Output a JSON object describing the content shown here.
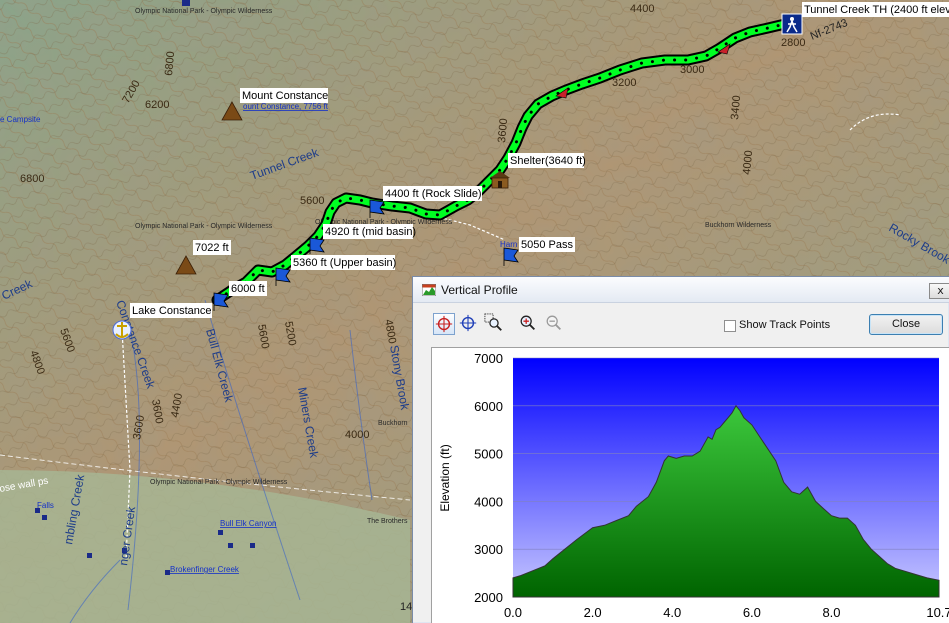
{
  "map": {
    "contour_labels": [
      "4400",
      "6800",
      "7200",
      "6200",
      "6800",
      "5600",
      "4800",
      "5600",
      "4400",
      "3600",
      "3600",
      "5600",
      "5200",
      "4800",
      "4000",
      "4000",
      "3200",
      "3400",
      "3600",
      "3000",
      "2800"
    ],
    "creek_labels": [
      "Tunnel Creek",
      "Creek",
      "Constance Creek",
      "Bull Elk Creek",
      "Miners Creek",
      "Stony Brook",
      "mbling Creek",
      "nger Creek",
      "Rocky Brook"
    ],
    "area_labels": [
      "Olympic National Park - Olympic Wilderness",
      "Olympic National Park - Olympic Wilderness",
      "Olympic National Park - Olympic Wilderness",
      "Olympic National Park - Olympic Wilderness",
      "Buckhorn Wilderness",
      "Buckhorn",
      "The Brothers",
      "ose wall ps"
    ],
    "blue_labels": [
      "e Campsite",
      "ount Constance, 7756 ft",
      "Bull Elk Canyon",
      "Brokenfinger Creek",
      "Falls",
      "Harn"
    ],
    "road_label": "Nf-2743",
    "edge_number": "14",
    "waypoints": [
      {
        "label": "Tunnel Creek TH (2400 ft elev"
      },
      {
        "label": "Shelter(3640 ft)"
      },
      {
        "label": "4400 ft (Rock Slide)"
      },
      {
        "label": "4920 ft (mid basin)"
      },
      {
        "label": "5050 Pass"
      },
      {
        "label": "5360 ft (Upper basin)"
      },
      {
        "label": "6000 ft"
      },
      {
        "label": "Lake Constance"
      },
      {
        "label": "7022 ft"
      },
      {
        "label": "Mount Constance"
      }
    ],
    "colors": {
      "track": "#00ff22",
      "track_outline": "#000000",
      "waypoint_bg": "#ffffff"
    }
  },
  "profile_window": {
    "title": "Vertical Profile",
    "close_glyph": "x",
    "toolbar": [
      {
        "icon": "crosshair-red-icon"
      },
      {
        "icon": "crosshair-blue-icon"
      },
      {
        "icon": "zoom-area-icon"
      },
      {
        "icon": "zoom-in-icon"
      },
      {
        "icon": "zoom-out-icon"
      }
    ],
    "show_track_points_label": "Show Track Points",
    "show_track_points_checked": false,
    "close_button_label": "Close"
  },
  "chart_data": {
    "type": "area",
    "title": "",
    "xlabel": "",
    "ylabel": "Elevation (ft)",
    "xlim": [
      0,
      10.7
    ],
    "ylim": [
      2000,
      7000
    ],
    "x_ticks": [
      "0.0",
      "2.0",
      "4.0",
      "6.0",
      "8.0",
      "10.7"
    ],
    "y_ticks": [
      "2000",
      "3000",
      "4000",
      "5000",
      "6000",
      "7000"
    ],
    "grid": true,
    "colors": {
      "background_top": "#0000ff",
      "background_bottom": "#c8c8ff",
      "fill_top": "#3cc83c",
      "fill_bottom": "#006400",
      "line": "#333333"
    },
    "x": [
      0,
      0.2,
      0.5,
      0.8,
      1.0,
      1.3,
      1.6,
      2.0,
      2.3,
      2.6,
      2.9,
      3.1,
      3.4,
      3.6,
      3.8,
      3.9,
      4.1,
      4.3,
      4.5,
      4.7,
      4.9,
      5.0,
      5.1,
      5.2,
      5.3,
      5.4,
      5.5,
      5.6,
      5.7,
      5.8,
      6.0,
      6.2,
      6.4,
      6.6,
      6.8,
      7.0,
      7.2,
      7.4,
      7.6,
      7.8,
      8.0,
      8.2,
      8.4,
      8.6,
      8.8,
      9.0,
      9.2,
      9.4,
      9.6,
      9.8,
      10.0,
      10.2,
      10.4,
      10.7
    ],
    "y": [
      2400,
      2450,
      2550,
      2650,
      2800,
      3000,
      3200,
      3450,
      3500,
      3600,
      3700,
      3900,
      4100,
      4400,
      4850,
      4950,
      4900,
      4950,
      4950,
      5050,
      5350,
      5300,
      5500,
      5550,
      5650,
      5750,
      5850,
      6000,
      5900,
      5750,
      5600,
      5350,
      5100,
      4850,
      4400,
      4200,
      4150,
      4300,
      4000,
      3850,
      3700,
      3650,
      3650,
      3500,
      3200,
      3000,
      2850,
      2700,
      2600,
      2550,
      2500,
      2450,
      2400,
      2350
    ]
  }
}
